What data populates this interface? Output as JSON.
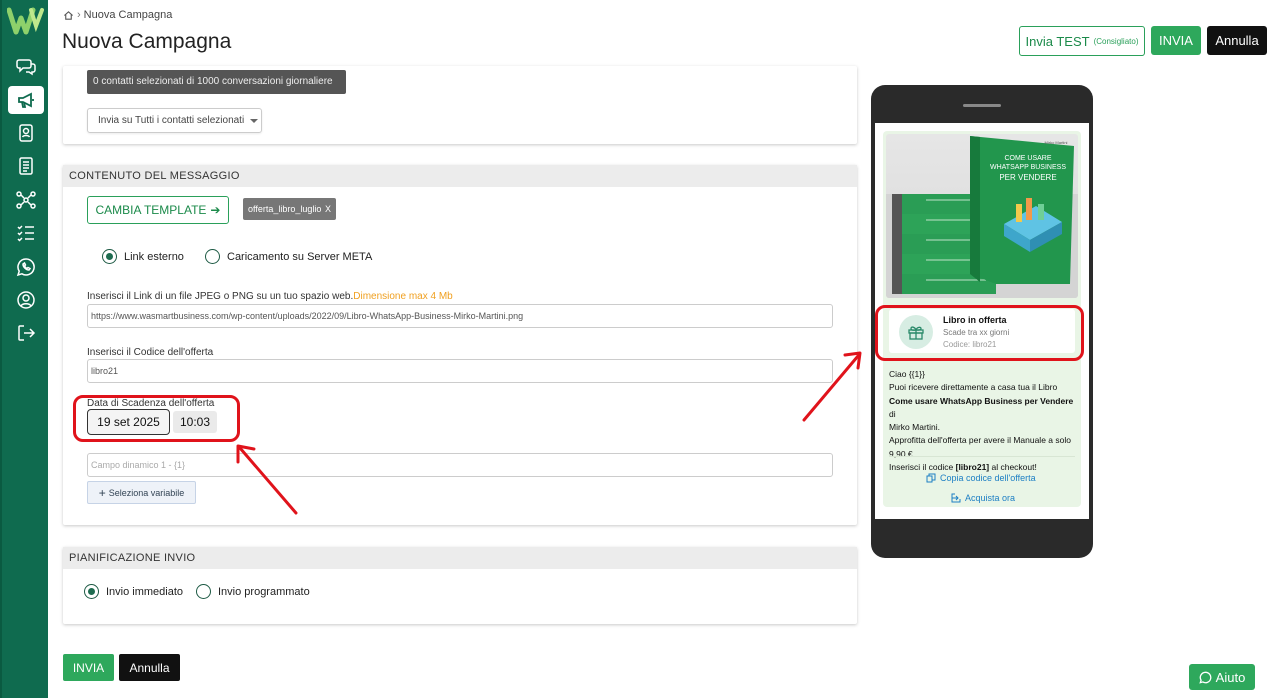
{
  "breadcrumb": {
    "current": "Nuova Campagna"
  },
  "header": {
    "title": "Nuova Campagna",
    "test_label": "Invia TEST",
    "test_hint": "(Consigliato)",
    "send_label": "INVIA",
    "cancel_label": "Annulla"
  },
  "sidebar": {
    "items": [
      {
        "icon": "chat-icon"
      },
      {
        "icon": "megaphone-icon",
        "active": true
      },
      {
        "icon": "contacts-icon"
      },
      {
        "icon": "document-icon"
      },
      {
        "icon": "flow-icon"
      },
      {
        "icon": "checklist-icon"
      },
      {
        "icon": "whatsapp-icon"
      },
      {
        "icon": "user-icon"
      },
      {
        "icon": "logout-icon"
      }
    ]
  },
  "recipients": {
    "tag_text": "0 contatti selezionati di 1000 conversazioni giornaliere",
    "select_value": "Invia su Tutti i contatti selezionati"
  },
  "message": {
    "header": "CONTENUTO DEL MESSAGGIO",
    "change_template_label": "CAMBIA TEMPLATE",
    "template_chip": "offerta_libro_luglio",
    "chip_close": "X",
    "radio_external": "Link esterno",
    "radio_meta": "Caricamento su Server META",
    "link_label": "Inserisci il Link di un file JPEG o PNG su un tuo spazio web.",
    "link_hint": "Dimensione max 4 Mb",
    "link_value": "https://www.wasmartbusiness.com/wp-content/uploads/2022/09/Libro-WhatsApp-Business-Mirko-Martini.png",
    "code_label": "Inserisci il Codice dell'offerta",
    "code_value": "libro21",
    "expiry_label": "Data di Scadenza dell'offerta",
    "expiry_date": "19 set 2025",
    "expiry_time": "10:03",
    "dynamic_placeholder": "Campo dinamico 1 - {1}",
    "select_variable_label": "Seleziona variabile"
  },
  "schedule": {
    "header": "PIANIFICAZIONE INVIO",
    "radio_immediate": "Invio immediato",
    "radio_scheduled": "Invio programmato"
  },
  "footer": {
    "send_label": "INVIA",
    "cancel_label": "Annulla"
  },
  "preview": {
    "book_title_line1": "COME USARE",
    "book_title_line2": "WHATSAPP BUSINESS",
    "book_title_line3": "PER VENDERE",
    "book_author": "Mirko Martini",
    "offer_title": "Libro in offerta",
    "offer_expiry": "Scade tra xx giorni",
    "offer_code": "Codice: libro21",
    "text_line1": "Ciao {{1}}",
    "text_line2": "Puoi ricevere direttamente a casa tua il Libro",
    "text_bold": "Come usare WhatsApp Business per Vendere",
    "text_line3a": " di",
    "text_line3b": "Mirko Martini.",
    "text_line4": "Approfitta dell'offerta per avere il Manuale a solo 9,90 €.",
    "text_line5a": "Inserisci il codice ",
    "text_line5bold": "[libro21]",
    "text_line5c": " al checkout!",
    "copy_code_label": "Copia codice dell'offerta",
    "buy_label": "Acquista ora"
  },
  "help": {
    "label": "Aiuto"
  },
  "colors": {
    "brand": "#0f6b4f",
    "accent": "#2ea85c",
    "highlight": "#e0131b",
    "warning": "#f0a020"
  }
}
